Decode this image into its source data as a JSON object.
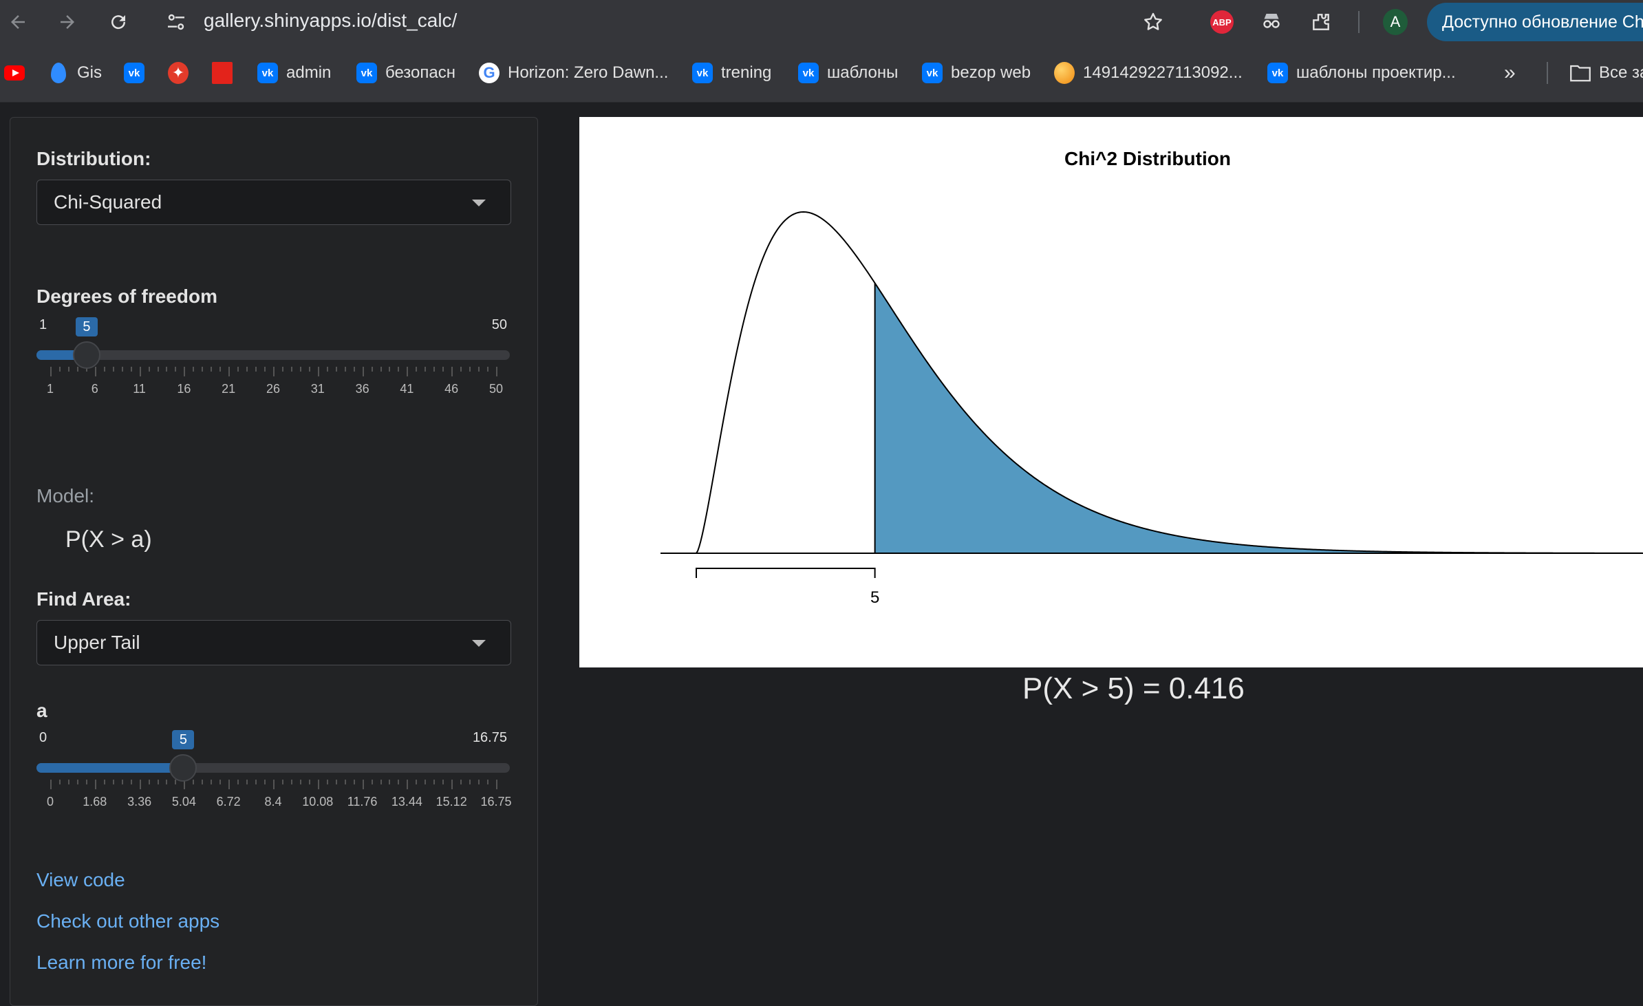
{
  "browser": {
    "url": "gallery.shinyapps.io/dist_calc/",
    "avatar_letter": "A",
    "abp_label": "ABP",
    "update_label": "Доступно обновление Chr"
  },
  "bookmarks": [
    {
      "icon": "youtube-icon",
      "label": ""
    },
    {
      "icon": "gis-icon",
      "label": "Gis"
    },
    {
      "icon": "vk-icon",
      "label": ""
    },
    {
      "icon": "yandex-zen-icon",
      "label": ""
    },
    {
      "icon": "red-square-icon",
      "label": ""
    },
    {
      "icon": "vk-icon",
      "label": "admin"
    },
    {
      "icon": "vk-icon",
      "label": "безопасн"
    },
    {
      "icon": "google-icon",
      "label": "Horizon: Zero Dawn..."
    },
    {
      "icon": "vk-icon",
      "label": "trening"
    },
    {
      "icon": "vk-icon",
      "label": "шаблоны"
    },
    {
      "icon": "vk-icon",
      "label": "bezop web"
    },
    {
      "icon": "ball-icon",
      "label": "1491429227113092..."
    },
    {
      "icon": "vk-icon",
      "label": "шаблоны проектир..."
    }
  ],
  "bookmarks_more": "»",
  "bookmarks_all": "Все за",
  "sidebar": {
    "distribution_label": "Distribution:",
    "distribution_value": "Chi-Squared",
    "df_label": "Degrees of freedom",
    "df_slider": {
      "min": 1,
      "max": 50,
      "value": 5,
      "min_label": "1",
      "max_label": "50",
      "tick_labels": [
        "1",
        "6",
        "11",
        "16",
        "21",
        "26",
        "31",
        "36",
        "41",
        "46",
        "50"
      ]
    },
    "model_label": "Model:",
    "model_value": "P(X > a)",
    "find_area_label": "Find Area:",
    "find_area_value": "Upper Tail",
    "a_label": "a",
    "a_slider": {
      "min": 0,
      "max": 16.75,
      "value": 5,
      "min_label": "0",
      "max_label": "16.75",
      "tick_labels": [
        "0",
        "1.68",
        "3.36",
        "5.04",
        "6.72",
        "8.4",
        "10.08",
        "11.76",
        "13.44",
        "15.12",
        "16.75"
      ]
    },
    "links": [
      "View code",
      "Check out other apps",
      "Learn more for free!"
    ]
  },
  "plot": {
    "title": "Chi^2 Distribution",
    "df": 5,
    "a": 5,
    "x_range": [
      0,
      26.5
    ],
    "tick_label": "5",
    "fill_color": "#5499c1"
  },
  "result_text": "P(X > 5) = 0.416"
}
